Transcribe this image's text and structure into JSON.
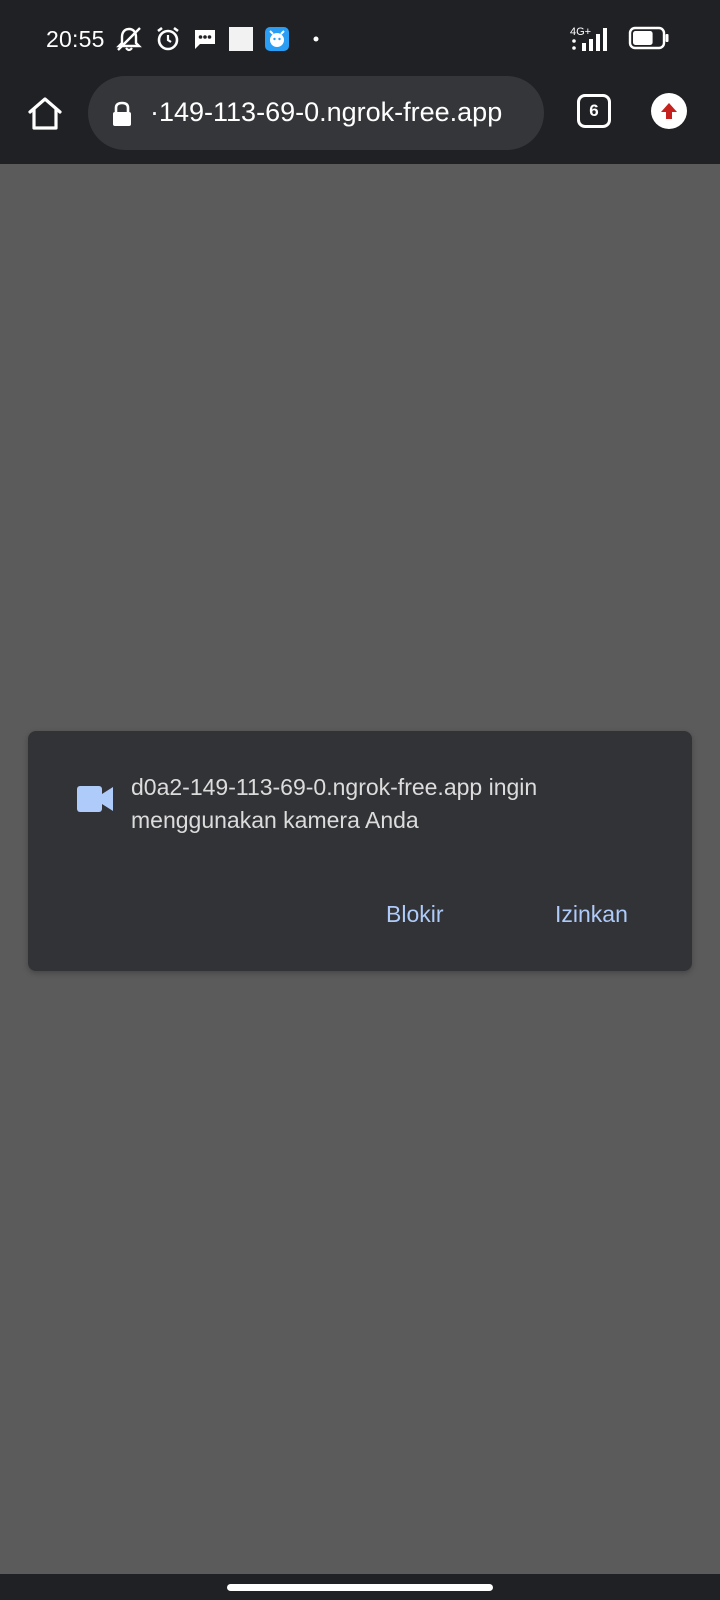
{
  "status_bar": {
    "time": "20:55",
    "notification_icons": [
      "mute-alarm-icon",
      "alarm-clock-icon",
      "message-icon",
      "blank-notification-icon",
      "app-notification-icon",
      "dot-icon"
    ],
    "network": "4G+",
    "battery_level": 0.7
  },
  "toolbar": {
    "url": "·149-113-69-0.ngrok-free.app",
    "tab_count": "6"
  },
  "dialog": {
    "message": "d0a2-149-113-69-0.ngrok-free.app ingin menggunakan kamera Anda",
    "block_label": "Blokir",
    "allow_label": "Izinkan"
  },
  "colors": {
    "chrome_dark": "#202124",
    "omnibox": "#35363a",
    "page_background": "#5b5b5b",
    "dialog_background": "#323336",
    "accent_blue": "#aecbfa",
    "update_red": "#c5221f"
  }
}
